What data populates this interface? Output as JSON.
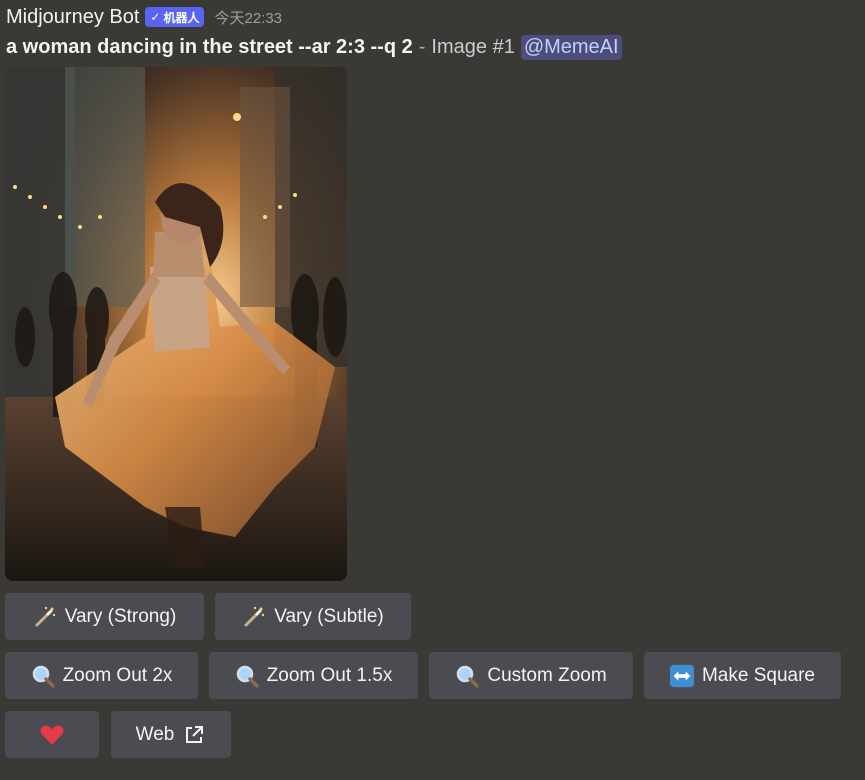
{
  "message": {
    "username": "Midjourney Bot",
    "bot_badge": "机器人",
    "timestamp": "今天22:33",
    "prompt": "a woman dancing in the street --ar 2:3 --q 2",
    "separator": "-",
    "image_label": "Image #1",
    "mention": "@MemeAI"
  },
  "buttons": {
    "vary_strong": "Vary (Strong)",
    "vary_subtle": "Vary (Subtle)",
    "zoom_out_2x": "Zoom Out 2x",
    "zoom_out_1_5x": "Zoom Out 1.5x",
    "custom_zoom": "Custom Zoom",
    "make_square": "Make Square",
    "web": "Web"
  },
  "icons": {
    "vary_strong": "magic-wand-icon",
    "vary_subtle": "magic-wand-icon",
    "zoom": "magnifier-icon",
    "make_square": "left-right-arrow-icon",
    "favorite": "heart-icon",
    "web": "external-link-icon"
  },
  "colors": {
    "background": "#3b3935",
    "button": "#4a4c52",
    "bot_badge": "#5865f2",
    "heart": "#e8394a",
    "mention_bg": "#4b4e7a"
  }
}
